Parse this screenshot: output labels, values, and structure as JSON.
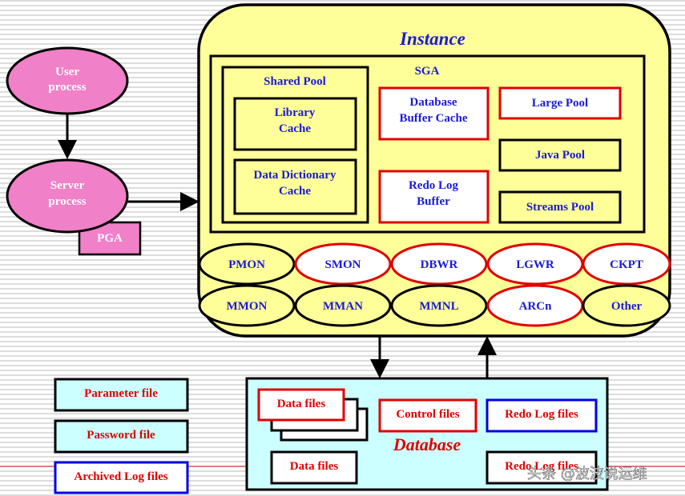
{
  "colors": {
    "instance_fill": "#ffff99",
    "database_fill": "#ccffff",
    "process_fill": "#f080c8",
    "red_border": "#e00000",
    "blue_border": "#0000e0",
    "label_blue": "#1a1ad6",
    "label_red": "#e00000"
  },
  "client": {
    "user_process": [
      "User",
      "process"
    ],
    "server_process": [
      "Server",
      "process"
    ],
    "pga": "PGA"
  },
  "instance": {
    "title": "Instance",
    "sga": {
      "title": "SGA",
      "shared_pool": {
        "title": "Shared Pool",
        "library_cache": [
          "Library",
          "Cache"
        ],
        "data_dictionary_cache": [
          "Data Dictionary",
          "Cache"
        ]
      },
      "database_buffer_cache": [
        "Database",
        "Buffer Cache"
      ],
      "redo_log_buffer": [
        "Redo Log",
        "Buffer"
      ],
      "large_pool": "Large Pool",
      "java_pool": "Java Pool",
      "streams_pool": "Streams Pool"
    },
    "processes_row1": [
      "PMON",
      "SMON",
      "DBWR",
      "LGWR",
      "CKPT"
    ],
    "processes_row2": [
      "MMON",
      "MMAN",
      "MMNL",
      "ARCn",
      "Other"
    ]
  },
  "database": {
    "title": "Database",
    "data_files": "Data files",
    "data_files_2": "Data files",
    "control_files": "Control files",
    "redo_log_files": "Redo Log files",
    "redo_log_files_2": "Redo Log files"
  },
  "external_files": {
    "parameter_file": "Parameter file",
    "password_file": "Password file",
    "archived_log_files": "Archived Log files"
  },
  "watermark": "头条 @波波说运维"
}
